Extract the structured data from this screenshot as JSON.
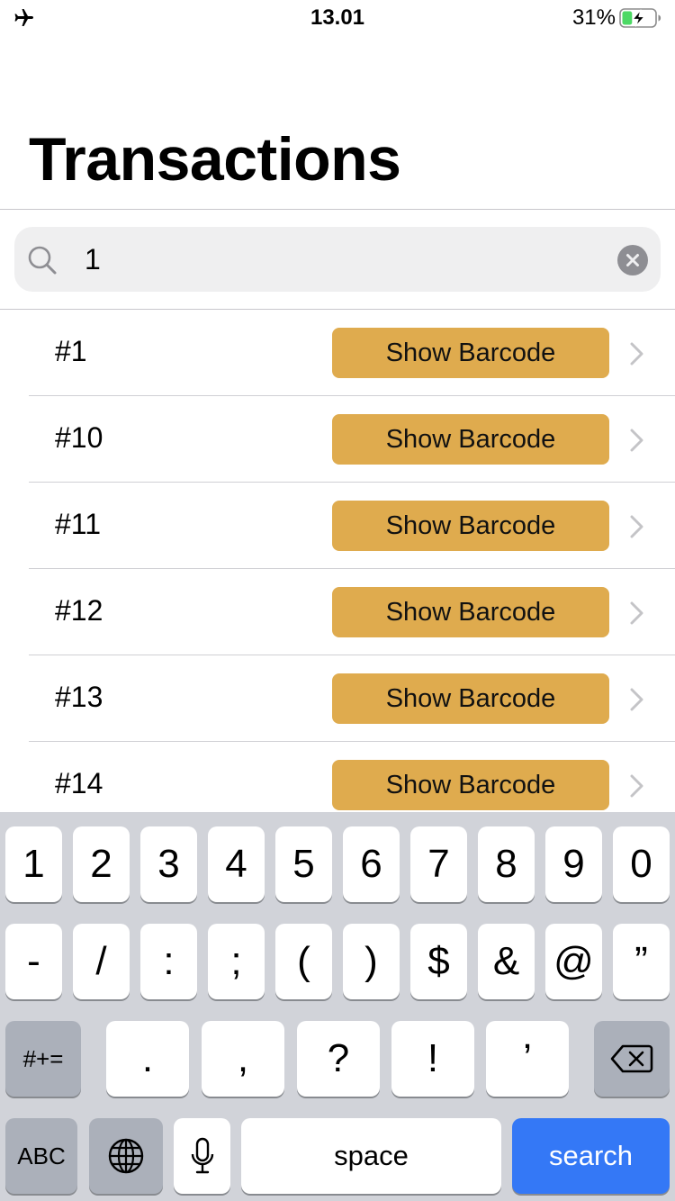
{
  "status_bar": {
    "time": "13.01",
    "battery_percent": "31%",
    "airplane_icon": "airplane-icon",
    "battery_icon": "battery-charging-icon",
    "battery_level": 0.31,
    "battery_color": "#4cd964"
  },
  "header": {
    "title": "Transactions"
  },
  "search": {
    "value": "1",
    "search_icon": "search-icon",
    "clear_icon": "clear-icon"
  },
  "transactions": [
    {
      "id": "#1",
      "button_label": "Show Barcode"
    },
    {
      "id": "#10",
      "button_label": "Show Barcode"
    },
    {
      "id": "#11",
      "button_label": "Show Barcode"
    },
    {
      "id": "#12",
      "button_label": "Show Barcode"
    },
    {
      "id": "#13",
      "button_label": "Show Barcode"
    },
    {
      "id": "#14",
      "button_label": "Show Barcode"
    }
  ],
  "colors": {
    "button": "#dfab4e",
    "search_key": "#3478f6",
    "keyboard_bg": "#d1d3d9"
  },
  "keyboard": {
    "row1": [
      "1",
      "2",
      "3",
      "4",
      "5",
      "6",
      "7",
      "8",
      "9",
      "0"
    ],
    "row2": [
      "-",
      "/",
      ":",
      ";",
      "(",
      ")",
      "$",
      "&",
      "@",
      "”"
    ],
    "row3_toggle": "#+=",
    "row3": [
      ".",
      ",",
      "?",
      "!",
      "’"
    ],
    "row3_delete_icon": "backspace-icon",
    "abc": "ABC",
    "globe_icon": "globe-icon",
    "mic_icon": "microphone-icon",
    "space": "space",
    "search": "search"
  }
}
